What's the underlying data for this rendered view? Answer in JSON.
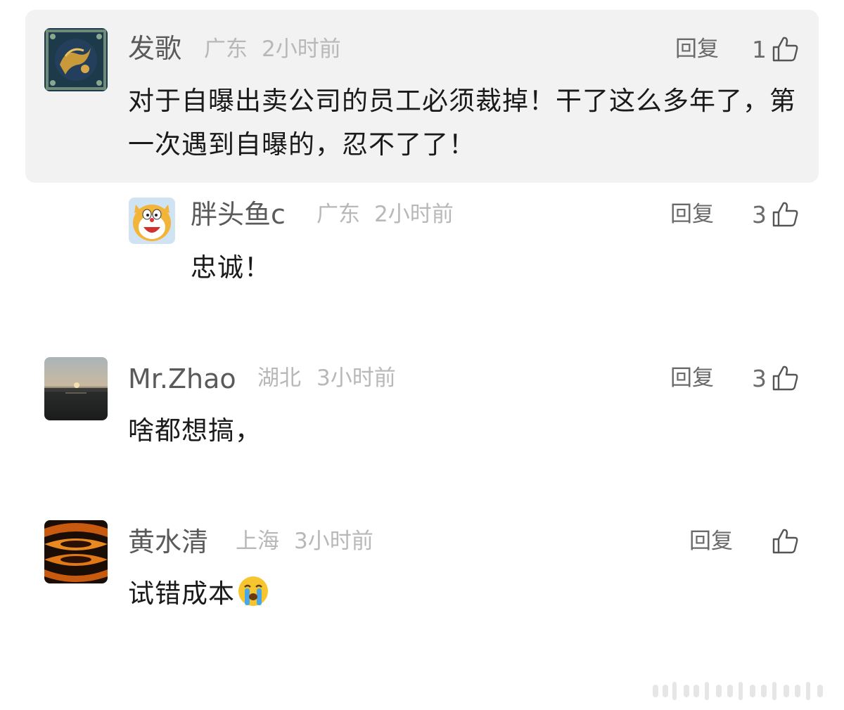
{
  "comments": [
    {
      "name": "发歌",
      "location": "广东",
      "time": "2小时前",
      "reply_label": "回复",
      "likes": "1",
      "text": "对于自曝出卖公司的员工必须裁掉！干了这么多年了，第一次遇到自曝的，忍不了了！",
      "avatar_icon": "dragon-pattern-avatar",
      "highlighted": true
    },
    {
      "name": "胖头鱼c",
      "location": "广东",
      "time": "2小时前",
      "reply_label": "回复",
      "likes": "3",
      "text": "忠诚！",
      "avatar_icon": "doraemon-avatar",
      "is_reply": true
    },
    {
      "name": "Mr.Zhao",
      "location": "湖北",
      "time": "3小时前",
      "reply_label": "回复",
      "likes": "3",
      "text": "啥都想搞，",
      "avatar_icon": "sunset-lake-avatar"
    },
    {
      "name": "黄水清",
      "location": "上海",
      "time": "3小时前",
      "reply_label": "回复",
      "likes": "",
      "text": "试错成本",
      "avatar_icon": "orange-pattern-avatar",
      "trailing_emoji": "crying-face-emoji"
    }
  ],
  "colors": {
    "highlight_background": "#f2f2f2",
    "name_text": "#5a5a5a",
    "meta_text": "#b8b8b8",
    "body_text": "#1a1a1a"
  }
}
